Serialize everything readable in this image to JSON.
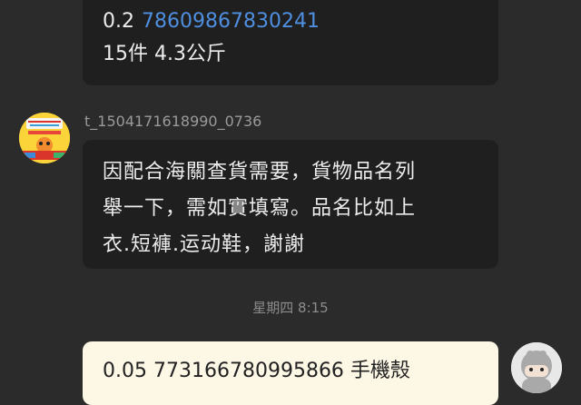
{
  "messages": {
    "top": {
      "line1_value": "0.2",
      "line1_link": "78609867830241",
      "line2": "15件 4.3公斤"
    },
    "middle": {
      "sender": "t_1504171618990_0736",
      "line1": "因配合海關查貨需要，貨物品名列",
      "line2": "舉一下，需如實填寫。品名比如上",
      "line3": "衣.短褲.运动鞋，謝謝"
    },
    "timestamp": "星期四 8:15",
    "bottom": {
      "text": "0.05 773166780995866 手機殼"
    }
  },
  "icons": {
    "left_avatar": "cartoon-shop-avatar-icon",
    "right_avatar": "hooded-character-avatar-icon"
  },
  "colors": {
    "background": "#2b2b2b",
    "incoming_bubble": "#1f1f1f",
    "outgoing_bubble": "#fdf7e6",
    "link": "#4f8fe0"
  }
}
